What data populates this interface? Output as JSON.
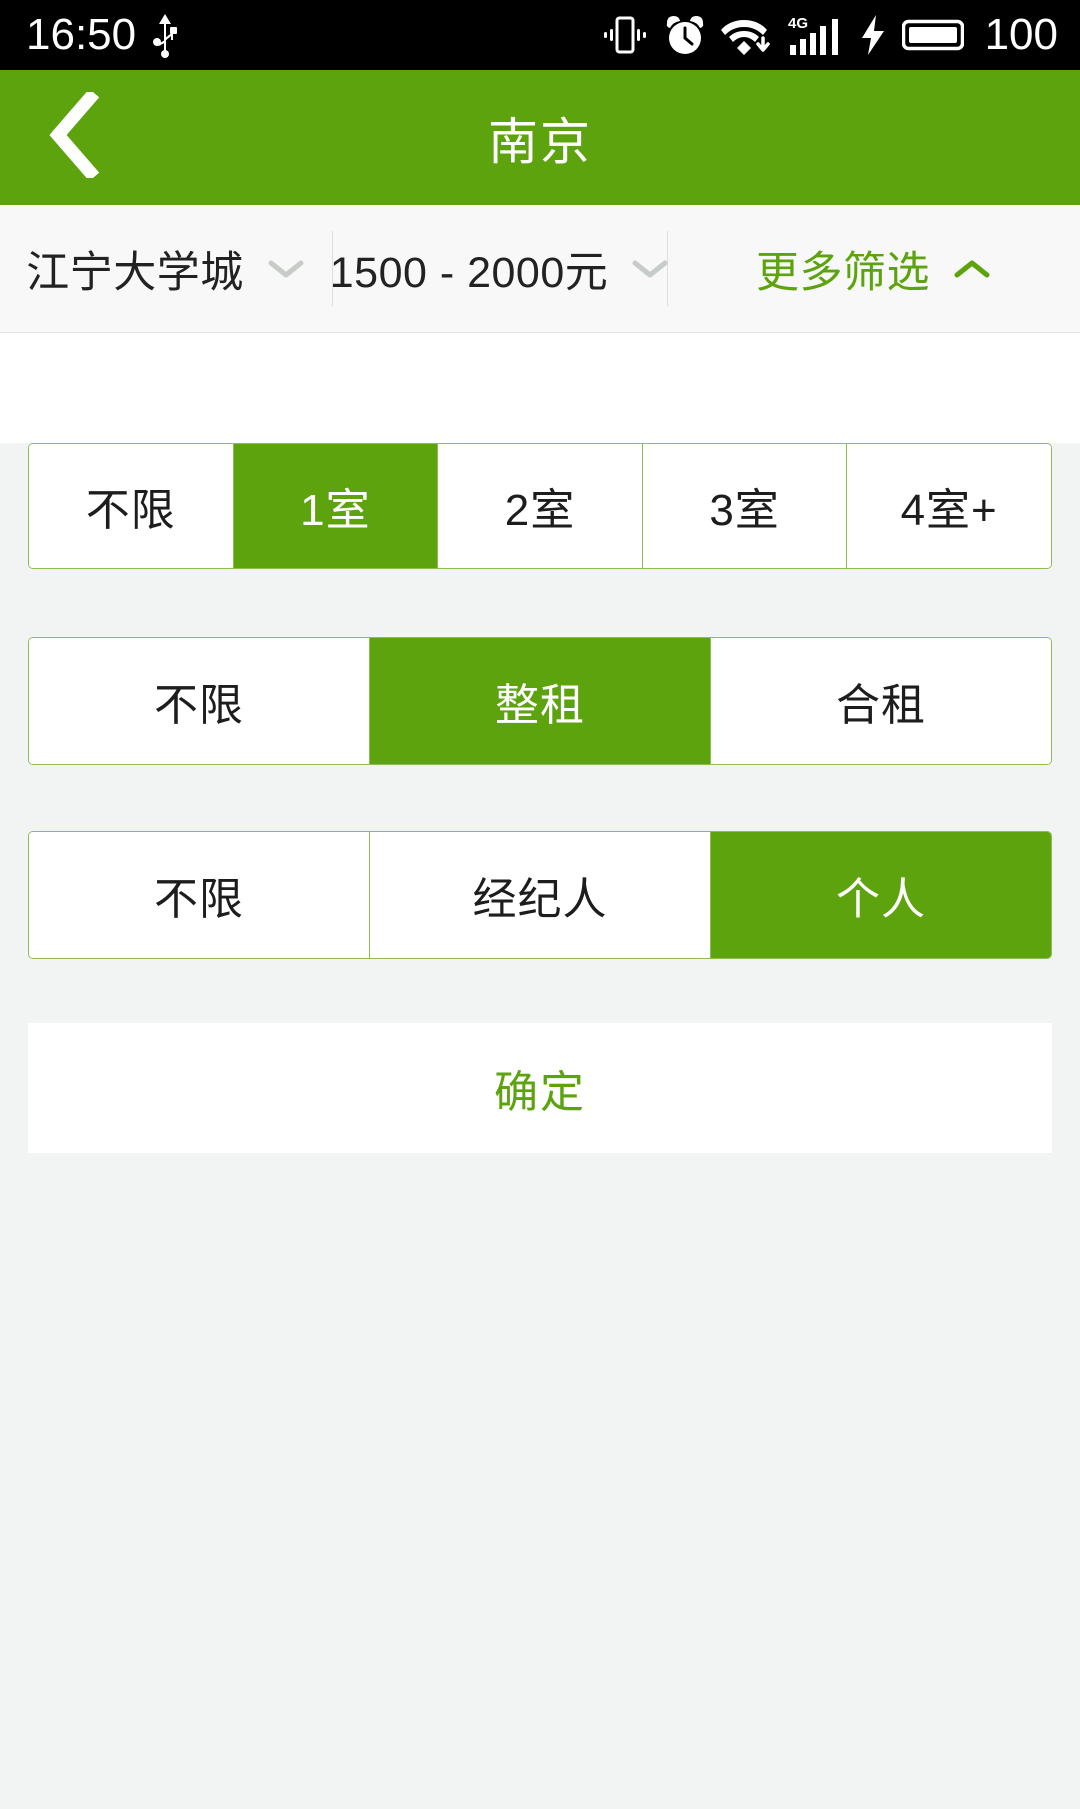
{
  "status_bar": {
    "time": "16:50",
    "battery_percent": "100",
    "icons": [
      "usb-icon",
      "vibrate-icon",
      "alarm-clock-icon",
      "wifi-download-icon",
      "4g-signal-icon",
      "charging-bolt-icon",
      "battery-icon"
    ],
    "network_label": "4G",
    "background": "#000000",
    "foreground": "#FFFFFF"
  },
  "header": {
    "title": "南京",
    "back_icon": "chevron-left-icon",
    "background": "#5CA30E",
    "text_color": "#FFFFFF"
  },
  "filter_bar": {
    "background": "#F7F8F7",
    "segments": [
      {
        "label": "江宁大学城",
        "icon": "chevron-down-icon",
        "active": false
      },
      {
        "label": "1500 - 2000元",
        "icon": "chevron-down-icon",
        "active": false
      },
      {
        "label": "更多筛选",
        "icon": "chevron-up-icon",
        "active": true
      }
    ]
  },
  "filters": {
    "accent": "#5CA30E",
    "border": "#8CBF4F",
    "page_background": "#F1F4F3",
    "rows": [
      {
        "name": "room-count",
        "options": [
          {
            "label": "不限",
            "selected": false
          },
          {
            "label": "1室",
            "selected": true
          },
          {
            "label": "2室",
            "selected": false
          },
          {
            "label": "3室",
            "selected": false
          },
          {
            "label": "4室+",
            "selected": false
          }
        ]
      },
      {
        "name": "rent-type",
        "options": [
          {
            "label": "不限",
            "selected": false
          },
          {
            "label": "整租",
            "selected": true
          },
          {
            "label": "合租",
            "selected": false
          }
        ]
      },
      {
        "name": "publisher-type",
        "options": [
          {
            "label": "不限",
            "selected": false
          },
          {
            "label": "经纪人",
            "selected": false
          },
          {
            "label": "个人",
            "selected": true
          }
        ]
      }
    ]
  },
  "confirm": {
    "label": "确定"
  }
}
